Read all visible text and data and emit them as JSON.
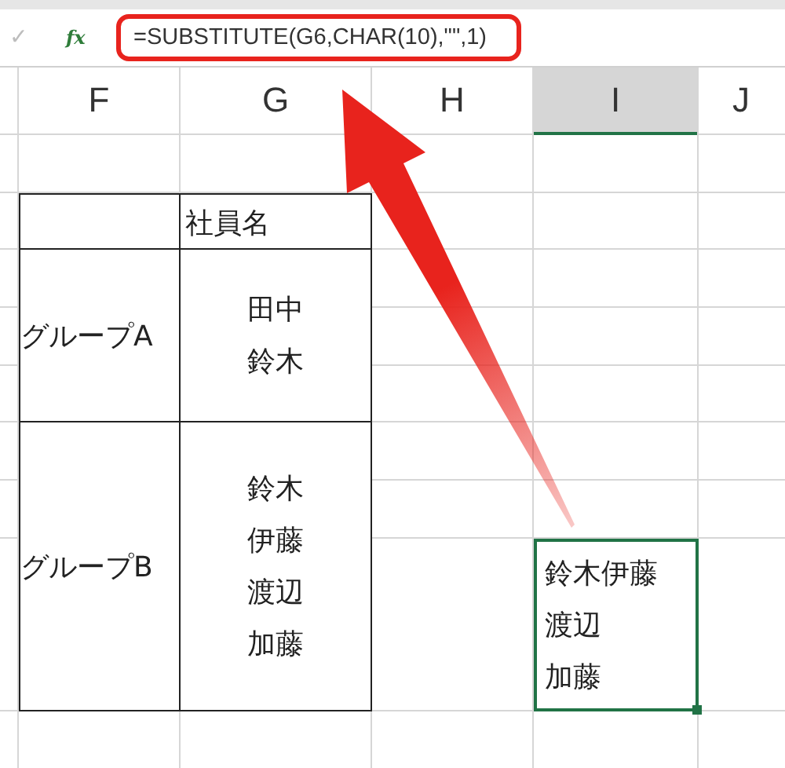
{
  "formula_bar": {
    "confirm_icon": "✓",
    "function_icon": "fx",
    "formula": "=SUBSTITUTE(G6,CHAR(10),\"\",1)",
    "highlighted": true
  },
  "column_headers": [
    {
      "label": "F",
      "selected": false
    },
    {
      "label": "G",
      "selected": false
    },
    {
      "label": "H",
      "selected": false
    },
    {
      "label": "I",
      "selected": true
    },
    {
      "label": "J",
      "selected": false
    }
  ],
  "table": {
    "name_header": "社員名",
    "rows": [
      {
        "group": "グループA",
        "names": [
          "田中",
          "鈴木"
        ]
      },
      {
        "group": "グループB",
        "names": [
          "鈴木",
          "伊藤",
          "渡辺",
          "加藤"
        ]
      }
    ]
  },
  "result_cell": {
    "lines": [
      "鈴木伊藤",
      "渡辺",
      "加藤"
    ],
    "selected": true
  }
}
